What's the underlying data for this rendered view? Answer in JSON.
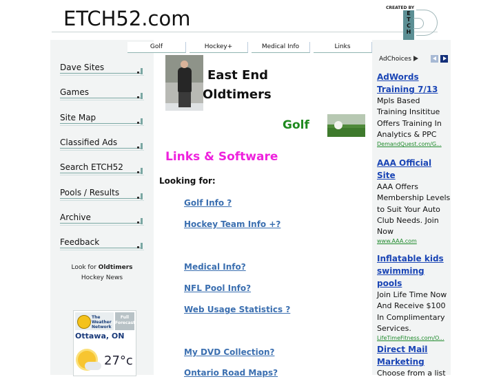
{
  "header": {
    "site_title": "ETCH52.com",
    "logo_created_by": "CREATED BY",
    "logo_letters": "E T C H"
  },
  "topnav": [
    {
      "label": "Golf"
    },
    {
      "label": "Hockey+"
    },
    {
      "label": "Medical Info"
    },
    {
      "label": "Links"
    }
  ],
  "sidebar": {
    "items": [
      {
        "label": "Dave Sites"
      },
      {
        "label": "Games"
      },
      {
        "label": "Site Map"
      },
      {
        "label": "Classified Ads"
      },
      {
        "label": "Search ETCH52"
      },
      {
        "label": "Pools / Results"
      },
      {
        "label": "Archive"
      },
      {
        "label": "Feedback"
      }
    ],
    "oldtimers_prefix": "Look for",
    "oldtimers_bold": "Oldtimers",
    "oldtimers_suffix": "Hockey News"
  },
  "weather": {
    "brand_line1": "The",
    "brand_line2": "Weather",
    "brand_line3": "Network",
    "full_forecast": "Full Forecast",
    "city": "Ottawa, ON",
    "temperature": "27°c",
    "icon": "sun-cloud-icon"
  },
  "main": {
    "title_line1": "East End",
    "title_line2": "Oldtimers",
    "golf_heading": "Golf",
    "links_heading": "Links & Software",
    "looking_for": "Looking for:",
    "links": [
      {
        "label": "Golf Info ?"
      },
      {
        "label": "Hockey Team Info +?"
      },
      {
        "label": "Medical Info?"
      },
      {
        "label": "NFL Pool Info?"
      },
      {
        "label": "Web Usage Statistics ?"
      },
      {
        "label": "My DVD Collection?"
      },
      {
        "label": "Ontario Road Maps?"
      }
    ]
  },
  "ads": {
    "adchoices_label": "AdChoices",
    "items": [
      {
        "title": "AdWords Training 7/13",
        "body": "Mpls Based Training Insititue Offers Training In Analytics & PPC",
        "url": "DemandQuest.com/G..."
      },
      {
        "title": "AAA Official Site",
        "body": "AAA Offers Membership Levels to Suit Your Auto Club Needs. Join Now",
        "url": "www.AAA.com"
      },
      {
        "title": "Inflatable kids swimming pools",
        "body": "Join Life Time Now And Receive $100 In Complimentary Services.",
        "url": "LifeTimeFitness.com/O..."
      },
      {
        "title": "Direct Mail Marketing",
        "body": "Choose from a list",
        "url": ""
      }
    ]
  },
  "colors": {
    "golf_green": "#1f8a1f",
    "links_magenta": "#ee22dd",
    "link_blue": "#3b6fb0",
    "ad_title_blue": "#1a45b5",
    "ad_url_green": "#1f8a2c"
  }
}
